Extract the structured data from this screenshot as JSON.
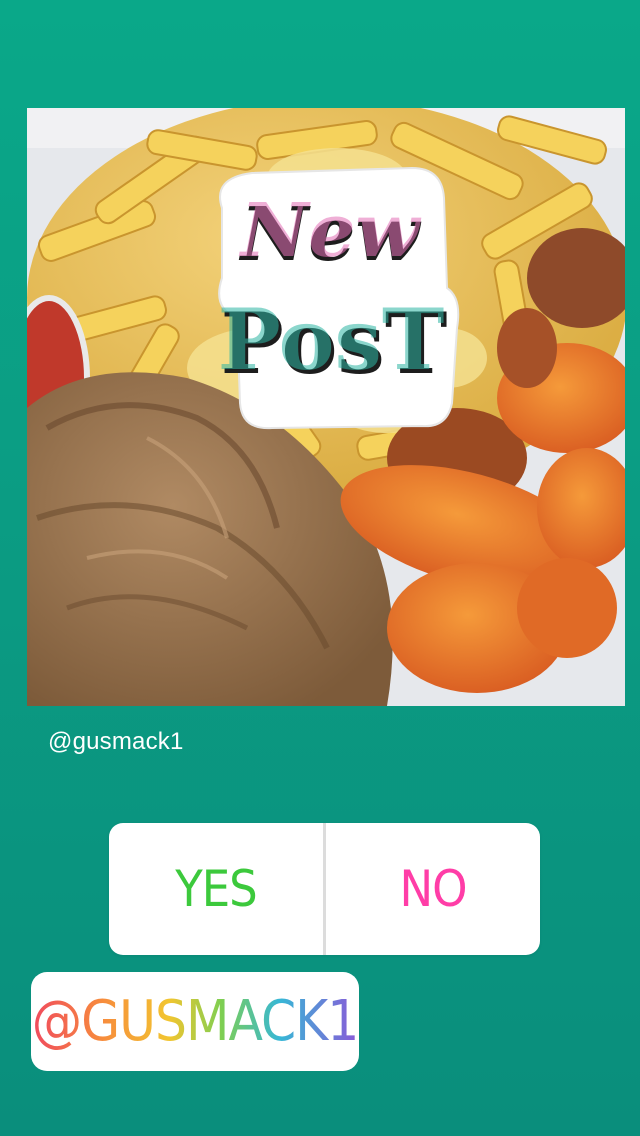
{
  "story": {
    "caption_handle": "@gusmack1",
    "sticker_line1": "New",
    "sticker_line2": "PosT"
  },
  "poll": {
    "yes_label": "YES",
    "no_label": "NO",
    "colors": {
      "yes": "#3cc93c",
      "no": "#ff3da7"
    }
  },
  "mention": {
    "label": "@GUSMACK1"
  },
  "colors": {
    "background_top": "#0aa889",
    "background_bottom": "#0a8e7c"
  }
}
